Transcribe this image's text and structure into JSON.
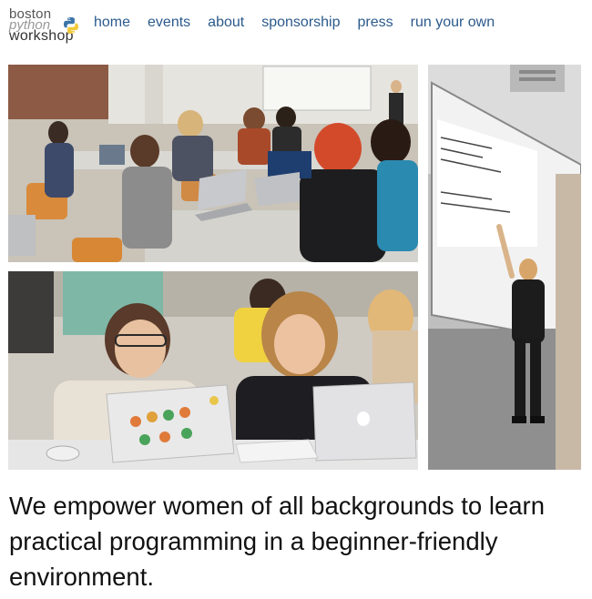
{
  "logo": {
    "line1": "boston",
    "line2": "python",
    "line3": "workshop"
  },
  "nav": {
    "items": [
      {
        "label": "home"
      },
      {
        "label": "events"
      },
      {
        "label": "about"
      },
      {
        "label": "sponsorship"
      },
      {
        "label": "press"
      },
      {
        "label": "run your own"
      }
    ]
  },
  "photos": [
    {
      "subject": "classroom of women working on laptops with instructor at screen"
    },
    {
      "subject": "instructor pointing at projected code on screen"
    },
    {
      "subject": "two women smiling at laptops"
    }
  ],
  "tagline": "We empower women of all backgrounds to learn practical programming in a beginner-friendly environment.",
  "colors": {
    "nav_link": "#2c5a8c",
    "text": "#111111",
    "background": "#ffffff"
  }
}
